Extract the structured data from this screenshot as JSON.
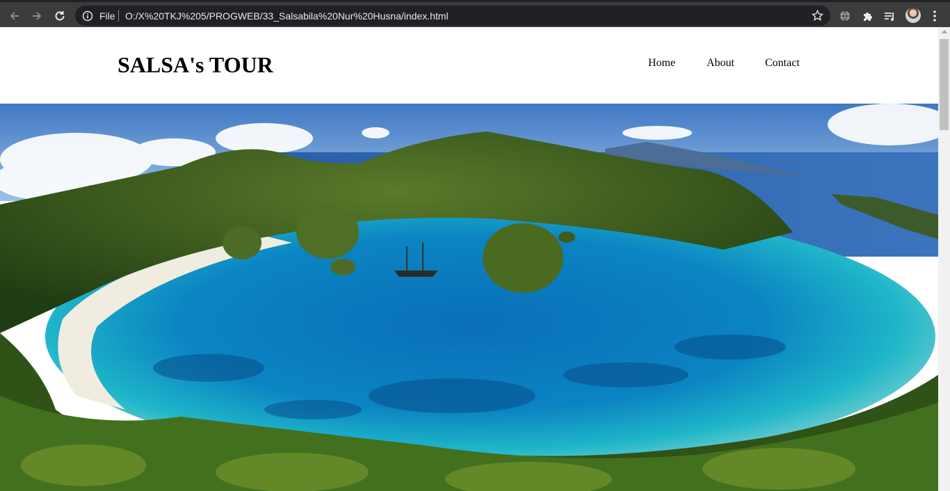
{
  "browser": {
    "url_scheme_label": "File",
    "url": "O:/X%20TKJ%205/PROGWEB/33_Salsabila%20Nur%20Husna/index.html"
  },
  "site": {
    "title": "SALSA's TOUR",
    "nav": [
      "Home",
      "About",
      "Contact"
    ]
  },
  "hero": {
    "image_subject": "tropical-lagoon-islands-photo"
  }
}
